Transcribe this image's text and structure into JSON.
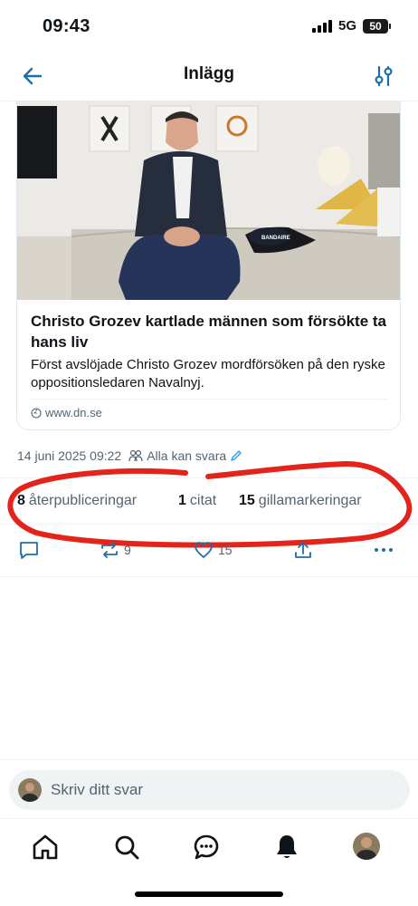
{
  "status_bar": {
    "time": "09:43",
    "network": "5G",
    "battery": "50"
  },
  "header": {
    "title": "Inlägg",
    "back_icon": "arrow-left-icon",
    "filter_icon": "sliders-icon"
  },
  "card": {
    "title": "Christo Grozev kartlade männen som försökte ta hans liv",
    "description": "Först avslöjade Christo Grozev mordförsöken på den ryske oppositionsledaren Navalnyj.",
    "domain": "www.dn.se",
    "cap_text": "BANDAIRE"
  },
  "meta": {
    "timestamp": "14 juni 2025 09:22",
    "reply_setting": "Alla kan svara"
  },
  "stats": {
    "reposts_count": "8",
    "reposts_label": "återpubliceringar",
    "quotes_count": "1",
    "quotes_label": "citat",
    "likes_count": "15",
    "likes_label": "gillamarkeringar"
  },
  "actions": {
    "reply_count": "",
    "repost_count": "9",
    "like_count": "15"
  },
  "reply_box": {
    "placeholder": "Skriv ditt svar"
  },
  "tabs": [
    "home-icon",
    "search-icon",
    "messages-icon",
    "notifications-icon",
    "profile-avatar"
  ],
  "colors": {
    "accent": "#1d9bf0",
    "icon_blue": "#1d6fa8",
    "text_secondary": "#536471",
    "annotation_red": "#e4231b"
  }
}
